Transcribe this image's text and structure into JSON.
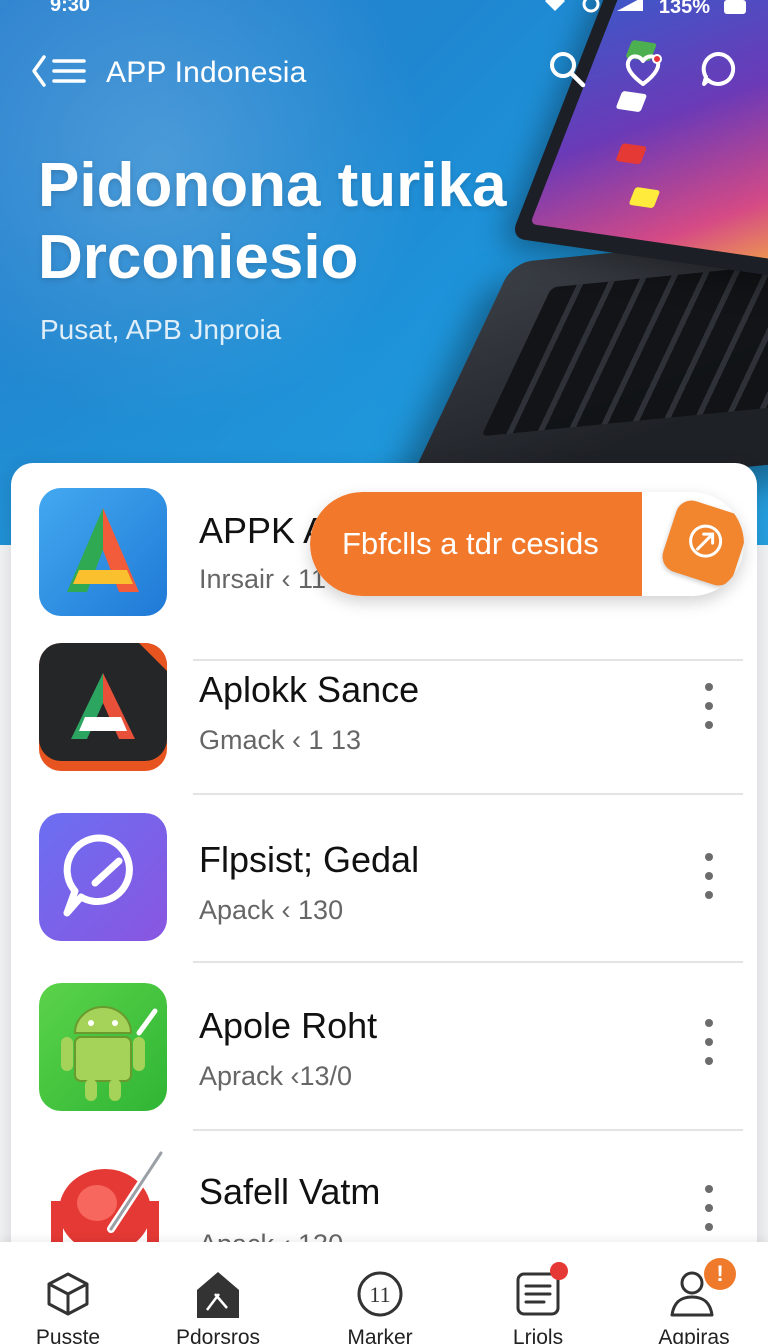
{
  "status_bar": {
    "time": "9:30",
    "battery": "135%"
  },
  "header": {
    "app_title": "APP Indonesia",
    "hero_title_line1": "Pidonona turika",
    "hero_title_line2": "Drconiesio",
    "hero_subtitle": "Pusat, APB Jnproia"
  },
  "apps": [
    {
      "name": "APPK A",
      "sub": "Inrsair ‹ 11"
    },
    {
      "name": "Aplokk Sance",
      "sub": "Gmack ‹ 1 13"
    },
    {
      "name": "Flpsist; Gedal",
      "sub": "Apack ‹ 130"
    },
    {
      "name": "Apole Roht",
      "sub": "Aprack ‹13/0"
    },
    {
      "name": "Safell Vatm",
      "sub": "Apack ‹ 130"
    }
  ],
  "toast": {
    "text": "Fbfclls a tdr cesids"
  },
  "bottom_nav": [
    {
      "label": "Pusste",
      "icon": "cube-icon"
    },
    {
      "label": "Pdorsros",
      "icon": "house-icon"
    },
    {
      "label": "Marker",
      "icon": "marker-circle-icon"
    },
    {
      "label": "Lriols",
      "icon": "list-document-icon"
    },
    {
      "label": "Agpiras",
      "icon": "people-icon",
      "badge": "!"
    }
  ],
  "colors": {
    "accent": "#f2792c",
    "hero": "#1f86d0",
    "notify": "#e53935"
  }
}
